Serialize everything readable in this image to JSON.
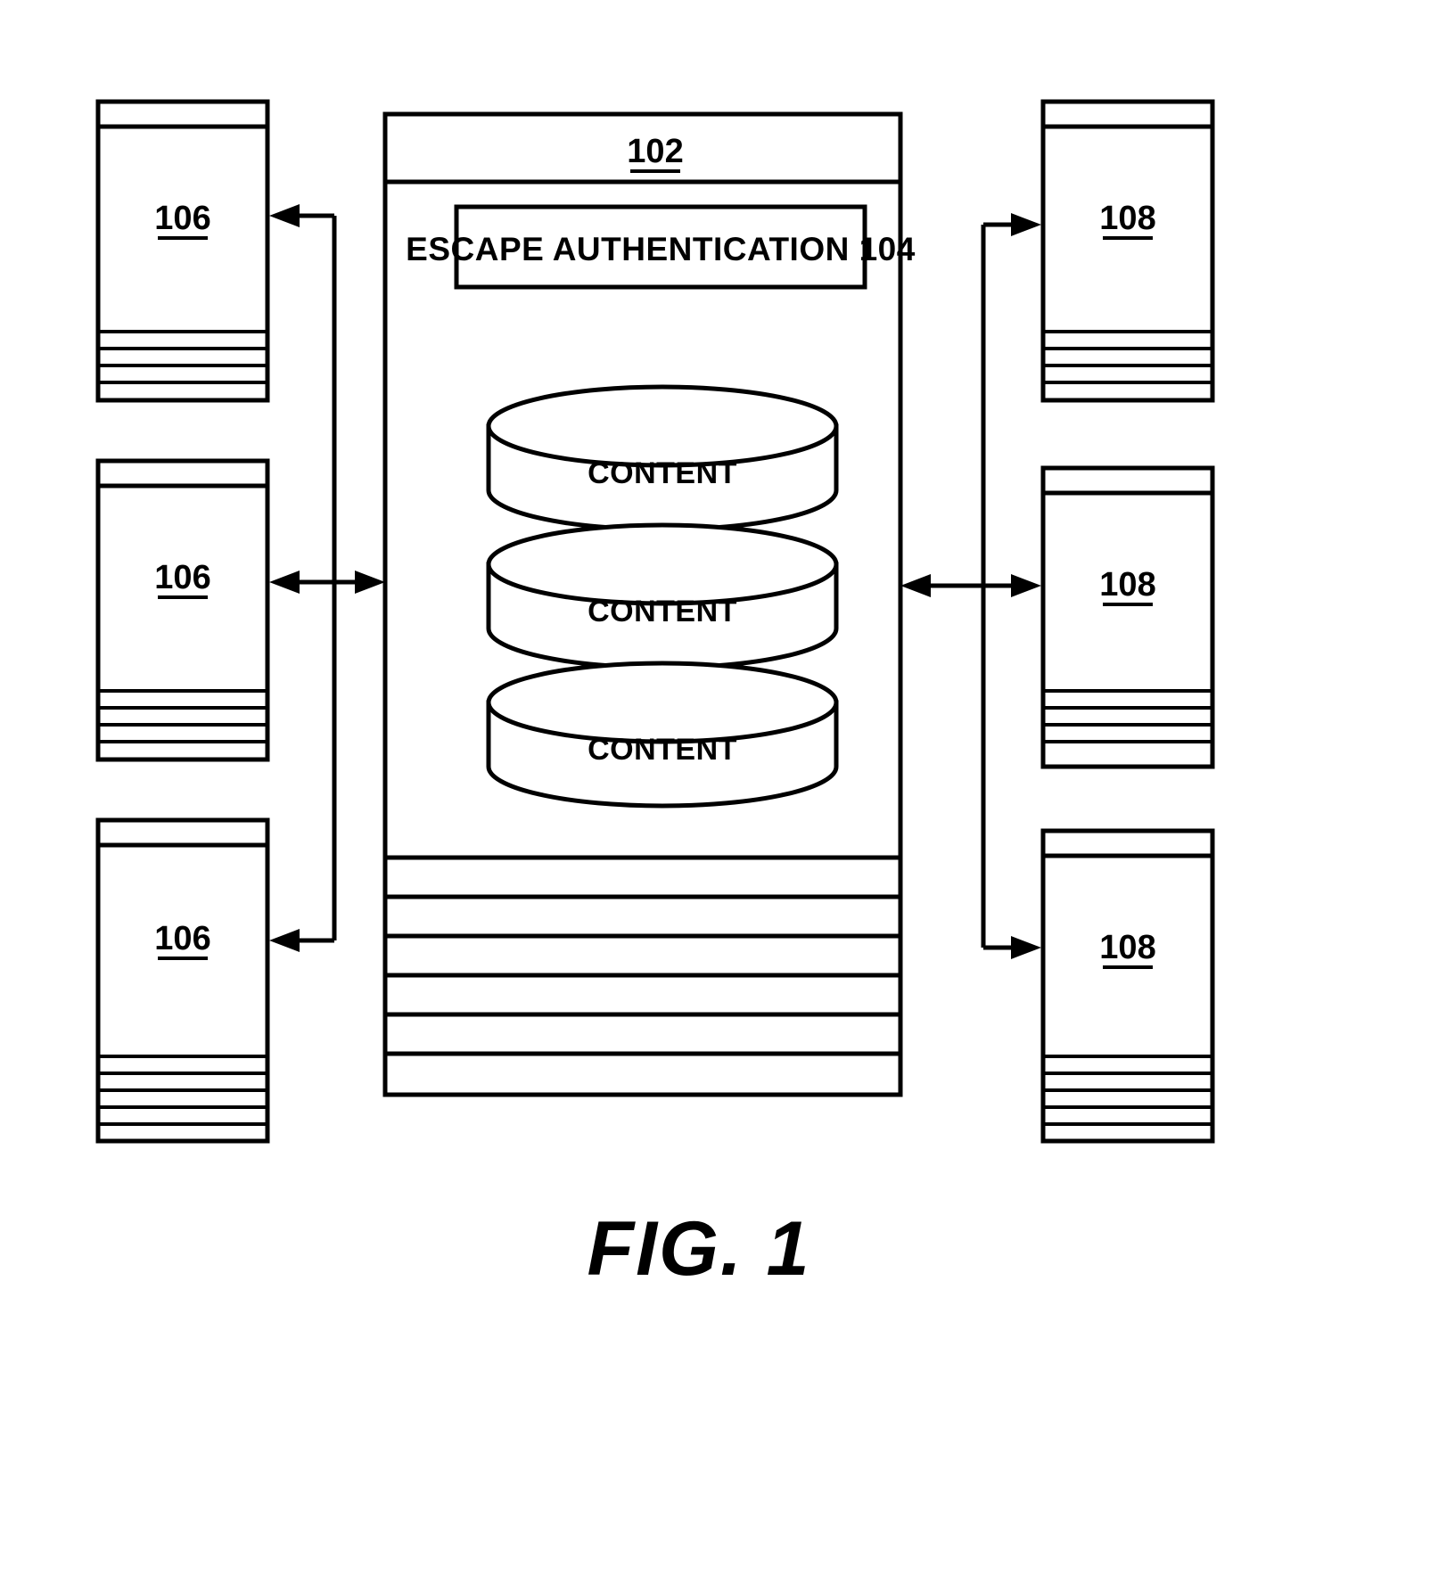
{
  "figure": {
    "caption": "FIG. 1",
    "system": {
      "label": "102",
      "module": {
        "label": "ESCAPE AUTHENTICATION 104"
      },
      "stores": [
        {
          "label": "CONTENT"
        },
        {
          "label": "CONTENT"
        },
        {
          "label": "CONTENT"
        }
      ]
    },
    "left_devices": [
      {
        "label": "106"
      },
      {
        "label": "106"
      },
      {
        "label": "106"
      }
    ],
    "right_devices": [
      {
        "label": "108"
      },
      {
        "label": "108"
      },
      {
        "label": "108"
      }
    ],
    "connectors": [
      {
        "name": "left-top-arrow",
        "direction": "to-device"
      },
      {
        "name": "left-middle-arrow",
        "direction": "bidirectional"
      },
      {
        "name": "left-bottom-arrow",
        "direction": "to-device"
      },
      {
        "name": "right-top-arrow",
        "direction": "to-device"
      },
      {
        "name": "right-middle-arrow",
        "direction": "bidirectional"
      },
      {
        "name": "right-bottom-arrow",
        "direction": "to-device"
      }
    ],
    "colors": {
      "ink": "#000000",
      "paper": "#ffffff"
    }
  }
}
